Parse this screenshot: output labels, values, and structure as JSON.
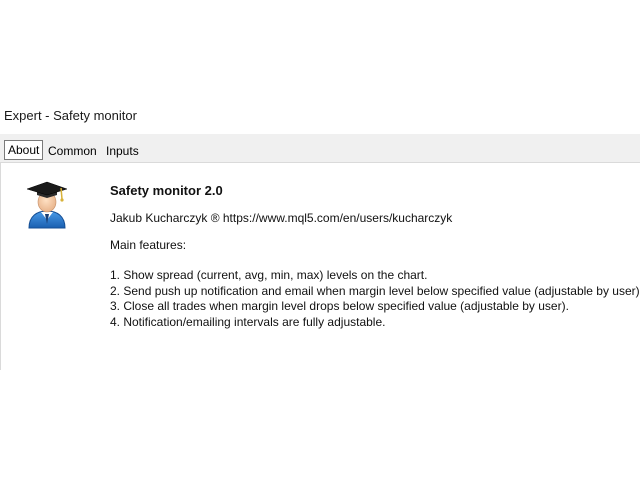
{
  "window": {
    "title": "Expert - Safety monitor"
  },
  "tabs": [
    {
      "label": "About",
      "active": true
    },
    {
      "label": "Common",
      "active": false
    },
    {
      "label": "Inputs",
      "active": false
    }
  ],
  "about": {
    "icon": "graduate-user-icon",
    "app_name": "Safety monitor 2.0",
    "author": "Jakub Kucharczyk ® https://www.mql5.com/en/users/kucharczyk",
    "features_label": "Main features:",
    "features": [
      "1. Show spread (current, avg, min, max) levels on the chart.",
      "2. Send push up notification and email when margin level below specified value (adjustable by user).",
      "3. Close all trades when margin level drops below specified value (adjustable by user).",
      "4. Notification/emailing intervals are fully adjustable."
    ]
  },
  "colors": {
    "tab_bar_bg": "#f0f0f0",
    "content_bg": "#ffffff",
    "icon_blue": "#1f73c8",
    "cap_black": "#1a1a1a"
  }
}
